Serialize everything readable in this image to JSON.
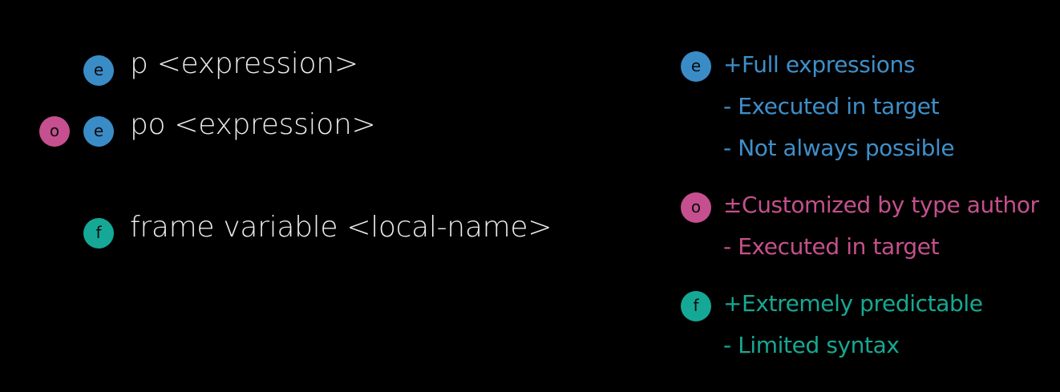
{
  "colors": {
    "background": "#000000",
    "expression_blue": "#3a8cc7",
    "object_pink": "#c6508f",
    "frame_teal": "#16a896",
    "command_text": "#ececec"
  },
  "badges": {
    "e": "e",
    "o": "o",
    "f": "f"
  },
  "commands": {
    "p": "p <expression>",
    "po": "po <expression>",
    "frame_variable": "frame variable <local-name>"
  },
  "notes": {
    "expression": {
      "line1": "+Full expressions",
      "line2": "- Executed in target",
      "line3": "- Not always possible"
    },
    "object": {
      "line1": "±Customized by type author",
      "line2": "- Executed in target"
    },
    "frame": {
      "line1": "+Extremely predictable",
      "line2": "- Limited syntax"
    }
  }
}
